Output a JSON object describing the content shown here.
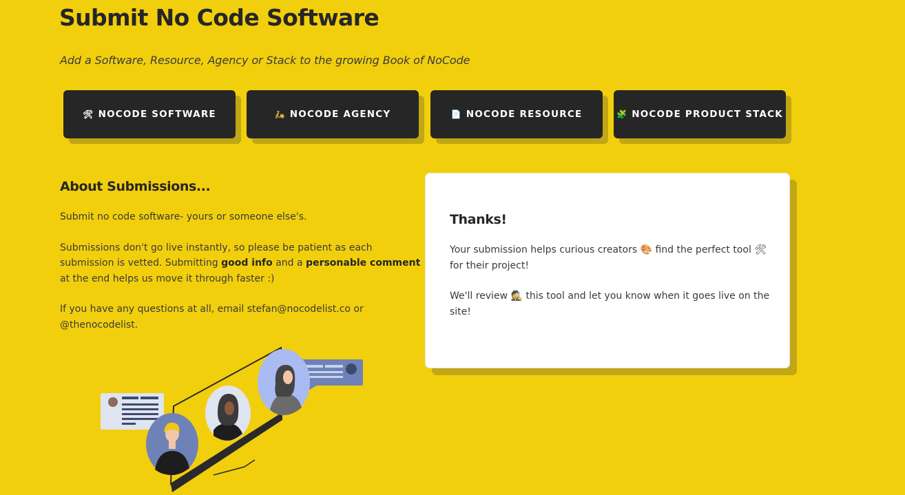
{
  "header": {
    "title": "Submit No Code Software",
    "subtitle": "Add a Software, Resource, Agency or Stack to the growing Book of NoCode"
  },
  "nav": {
    "buttons": [
      {
        "icon": "🛠",
        "icon_name": "hammer-wrench-icon",
        "label": "NOCODE SOFTWARE"
      },
      {
        "icon": "🛵",
        "icon_name": "scooter-icon",
        "label": "NOCODE AGENCY"
      },
      {
        "icon": "📄",
        "icon_name": "document-icon",
        "label": "NOCODE RESOURCE"
      },
      {
        "icon": "🧩",
        "icon_name": "puzzle-piece-icon",
        "label": "NOCODE PRODUCT STACK"
      }
    ]
  },
  "about": {
    "title": "About Submissions...",
    "p1": "Submit no code software- yours or someone else's.",
    "p2_a": "Submissions don't go live instantly, so please be patient as each submission is vetted. Submitting ",
    "p2_b": "good info",
    "p2_c": " and a ",
    "p2_d": "personable comment",
    "p2_e": " at the end helps us move it through faster :)",
    "p3": "If you have any questions at all, email stefan@nocodelist.co or @thenocodelist."
  },
  "thanks": {
    "title": "Thanks!",
    "p1_a": "Your submission helps curious creators ",
    "p1_icon": "🎨",
    "p1_b": " find the perfect tool ",
    "p1_icon2": "🛠",
    "p1_c": " for their project!",
    "p2_a": "We'll review ",
    "p2_icon": "🕵",
    "p2_b": " this tool and let you know when it goes live on the site!"
  },
  "colors": {
    "background": "#f2cf0c",
    "button_bg": "#262626",
    "shadow": "#c1a616",
    "card_bg": "#ffffff"
  }
}
